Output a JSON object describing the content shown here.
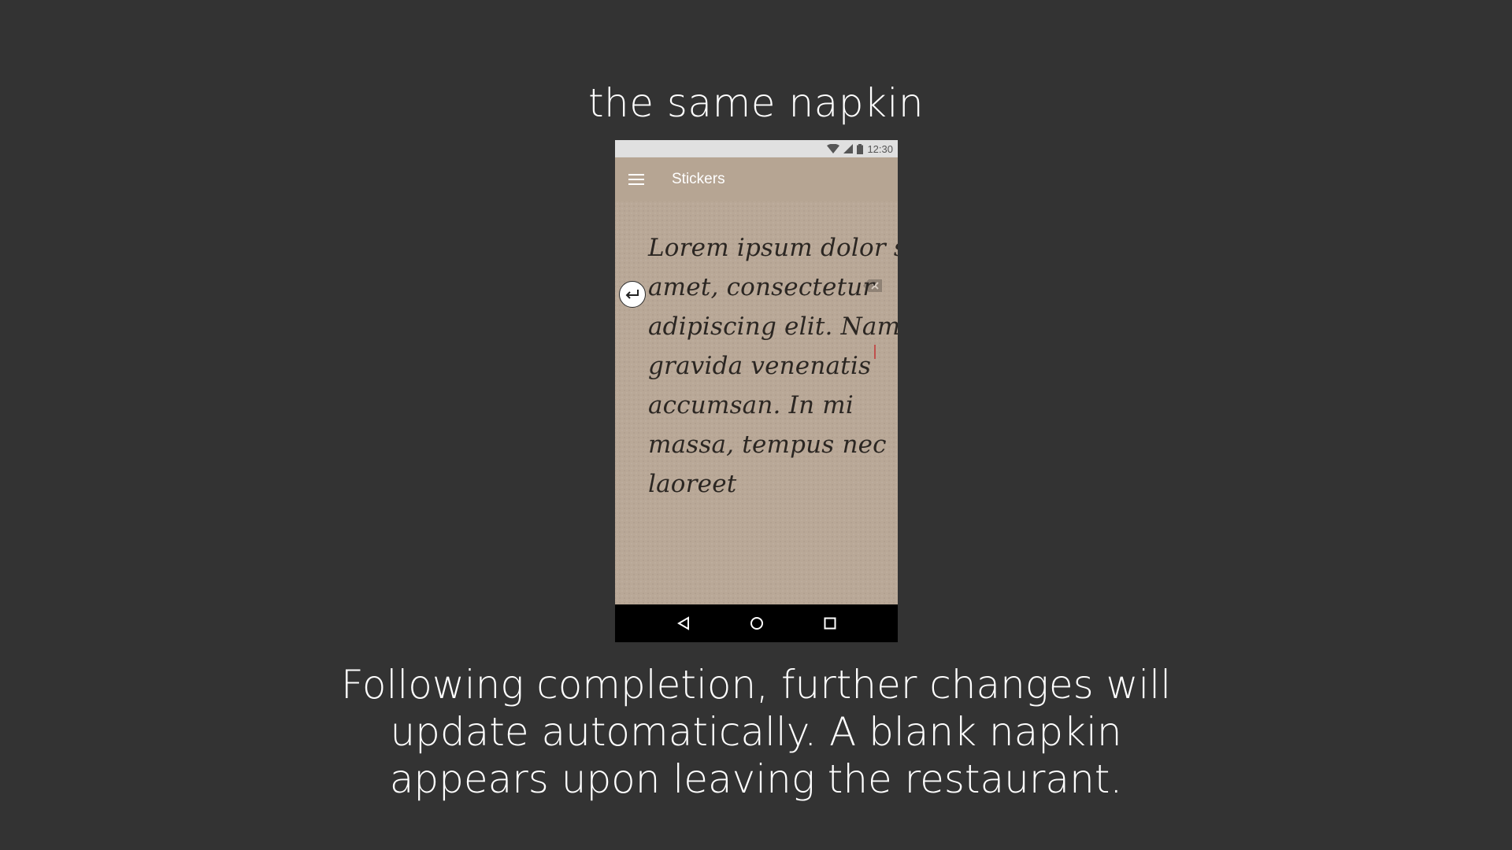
{
  "slide": {
    "title": "the same napkin",
    "caption_lines": [
      "Following completion, further changes will",
      "update automatically. A blank napkin",
      "appears upon leaving the restaurant."
    ]
  },
  "phone": {
    "status_bar": {
      "time": "12:30",
      "icons": [
        "wifi-icon",
        "signal-icon",
        "battery-icon"
      ]
    },
    "app_bar": {
      "menu_icon": "hamburger-menu-icon",
      "title": "Stickers"
    },
    "note": {
      "lines": [
        "Lorem ipsum dolor sit",
        "amet, consectetur",
        "adipiscing elit. Nam",
        "gravida venenatis",
        "accumsan. In mi",
        "massa, tempus nec",
        "laoreet"
      ]
    },
    "controls": {
      "undo_top_icon": "return-arrow-icon",
      "undo_bottom_icon": "return-arrow-icon",
      "delete_icon": "backspace-icon"
    },
    "nav_bar": {
      "icons": [
        "back-icon",
        "home-icon",
        "recents-icon"
      ]
    }
  },
  "colors": {
    "slide_background": "#333333",
    "napkin": "#b9a897",
    "app_bar": "#b6a593",
    "ink": "#2b2622",
    "cursor": "#c0504d"
  }
}
